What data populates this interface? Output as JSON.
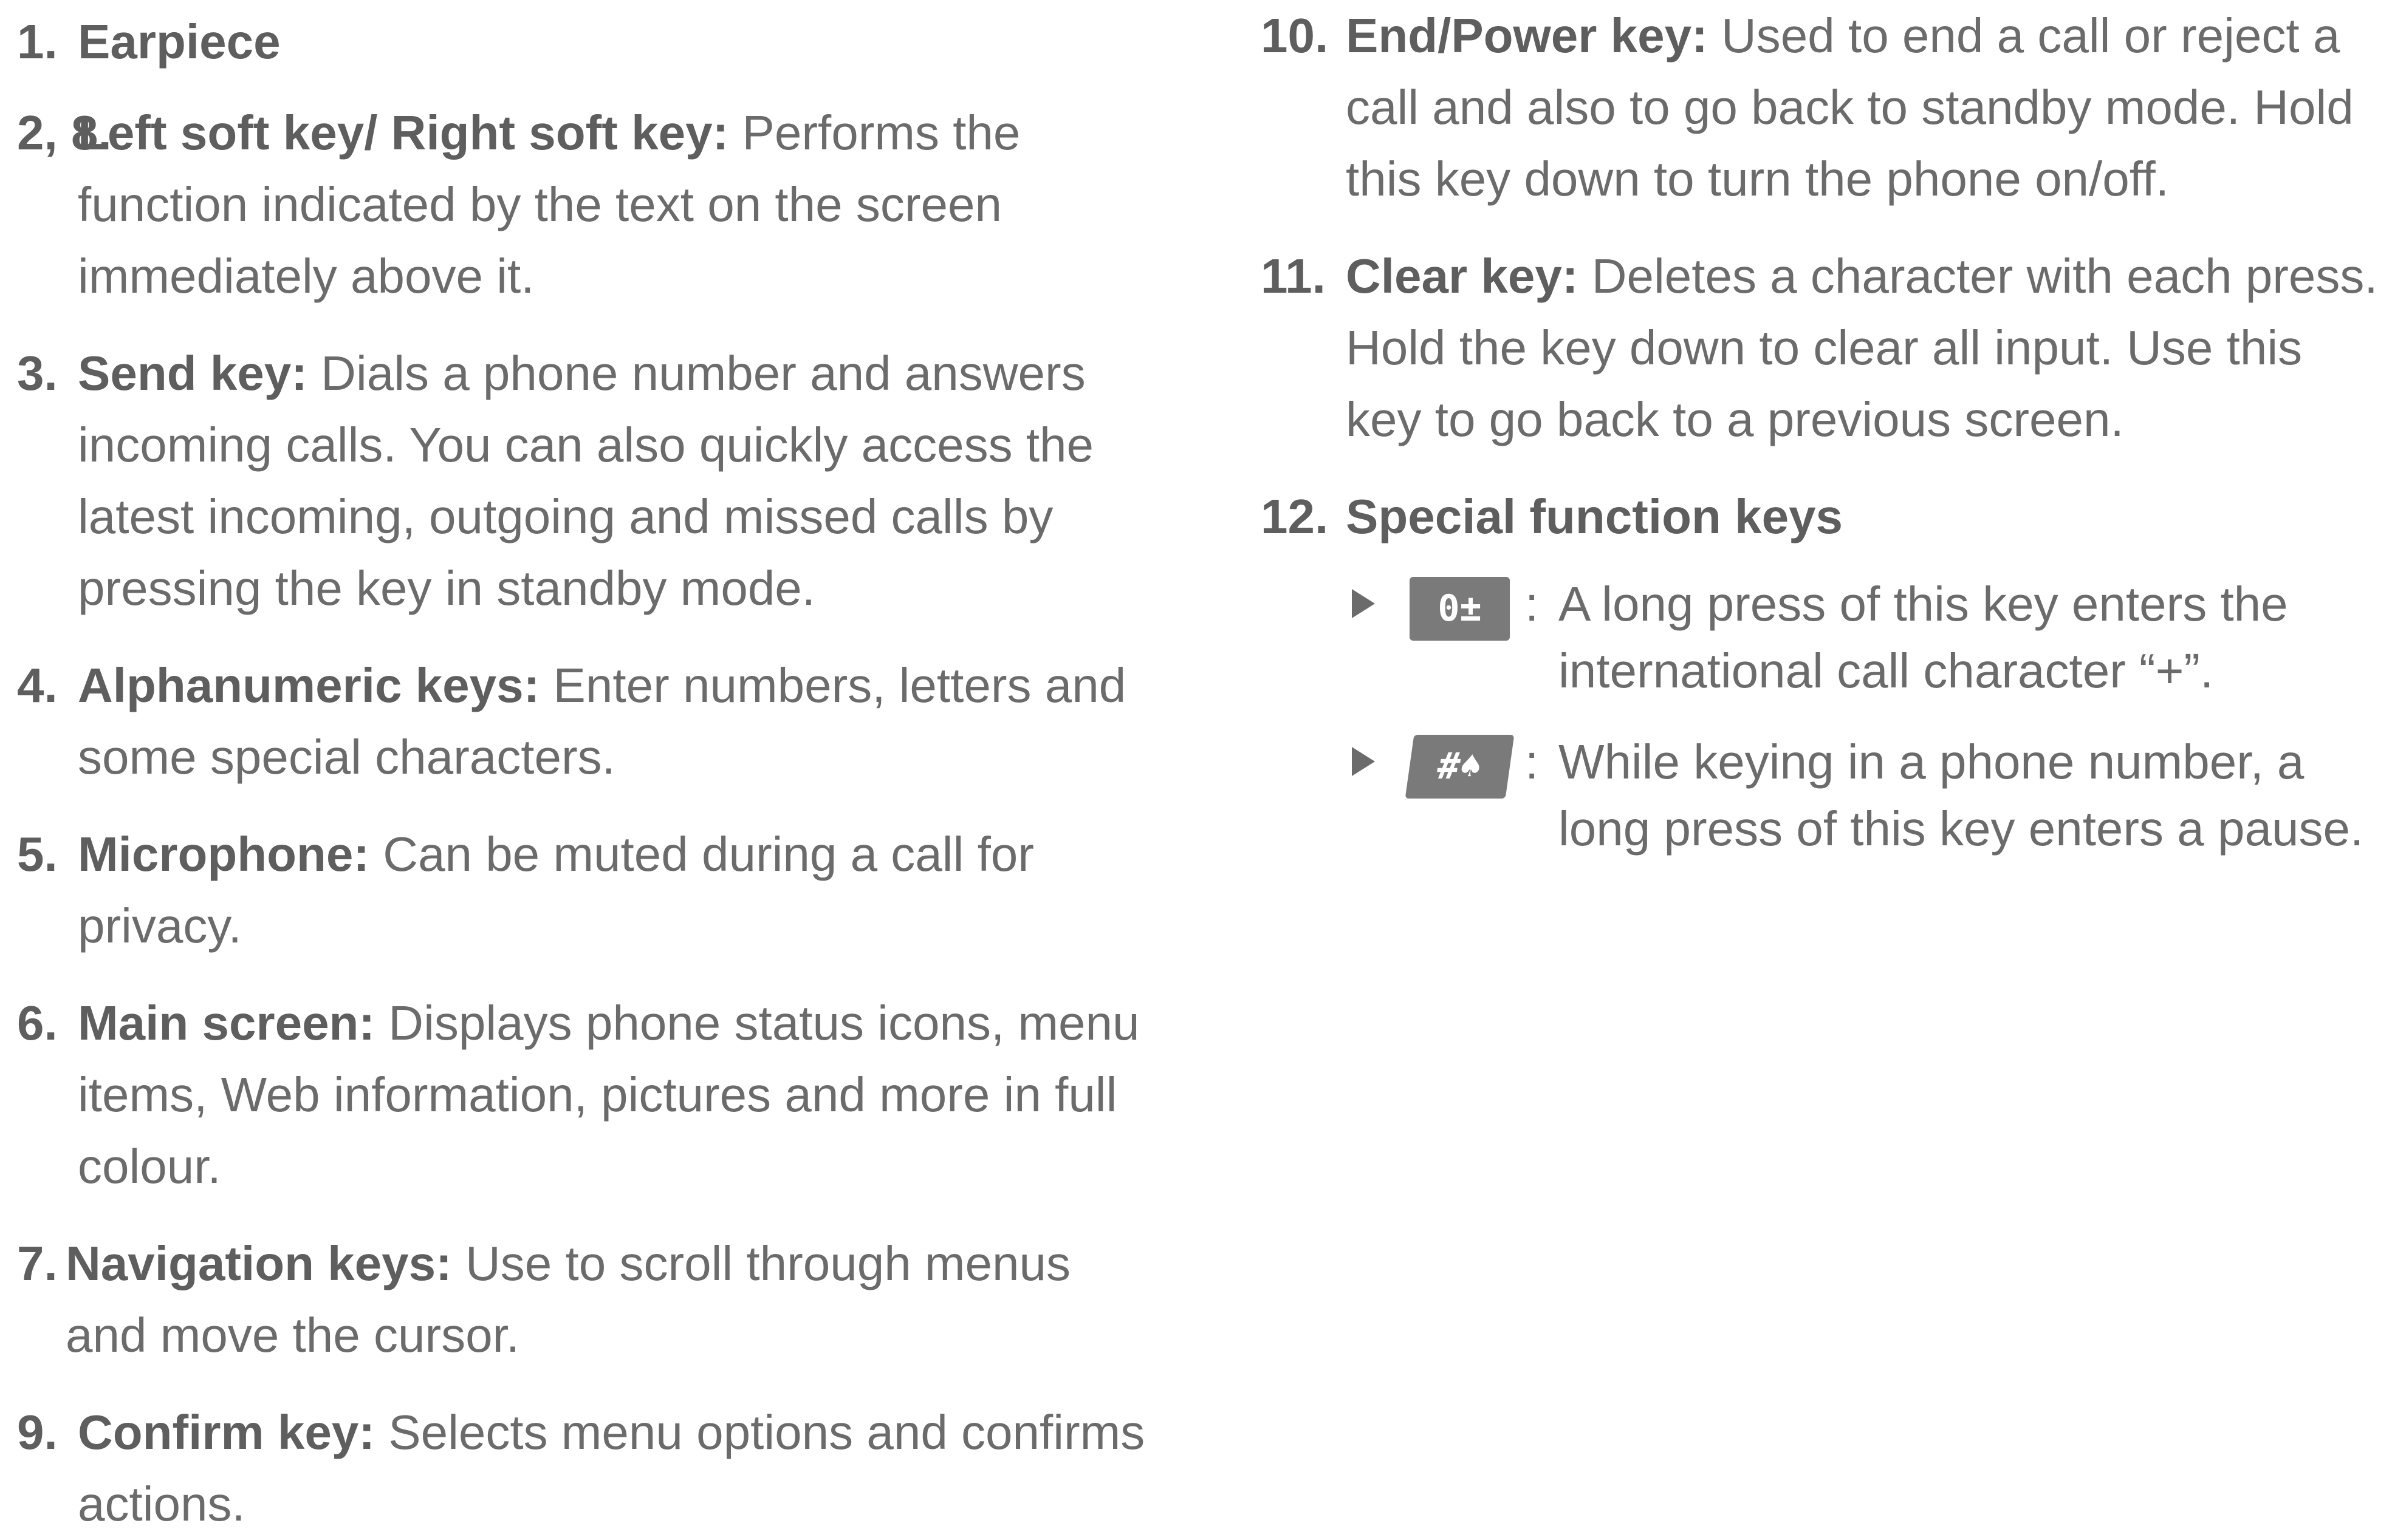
{
  "left_column": [
    {
      "num": "1.",
      "head": "Earpiece",
      "text": ""
    },
    {
      "num": "2, 8.",
      "head": "Left soft key/ Right soft key:",
      "text": "Performs the function indicated by the text on the screen immediately above it."
    },
    {
      "num": "3.",
      "head": "Send key:",
      "text": "Dials a phone number and answers incoming calls. You can also quickly access the latest incoming, outgoing and missed calls by pressing the key in standby mode."
    },
    {
      "num": "4.",
      "head": "Alphanumeric keys:",
      "text": "Enter numbers, letters and some special characters."
    },
    {
      "num": "5.",
      "head": "Microphone:",
      "text": "Can be muted during a call for privacy."
    },
    {
      "num": "6.",
      "head": "Main screen:",
      "text": "Displays phone status icons, menu items, Web information, pictures and more in full colour."
    },
    {
      "num": "7.",
      "head": "Navigation keys:",
      "text": "Use to scroll through menus and move the cursor."
    },
    {
      "num": "9.",
      "head": "Confirm key:",
      "text": "Selects menu options and confirms actions."
    }
  ],
  "right_column": [
    {
      "num": "10.",
      "head": "End/Power key:",
      "text": "Used to end a call or reject a call and also to go back to standby mode. Hold this key down to turn the phone on/off."
    },
    {
      "num": "11.",
      "head": "Clear key:",
      "text": "Deletes a character with each press. Hold the key down to clear all input. Use this key to go back to a previous screen."
    },
    {
      "num": "12.",
      "head": "Special function keys",
      "text": ""
    }
  ],
  "special_keys": [
    {
      "key_label": "0±",
      "icon": "zero-plus-key-icon",
      "text": "A long press of this key enters the international call character “+”."
    },
    {
      "key_label": "#♠",
      "icon": "hash-pause-key-icon",
      "text": "While keying in a phone number, a long press of this key enters a pause."
    }
  ],
  "colon": ":"
}
